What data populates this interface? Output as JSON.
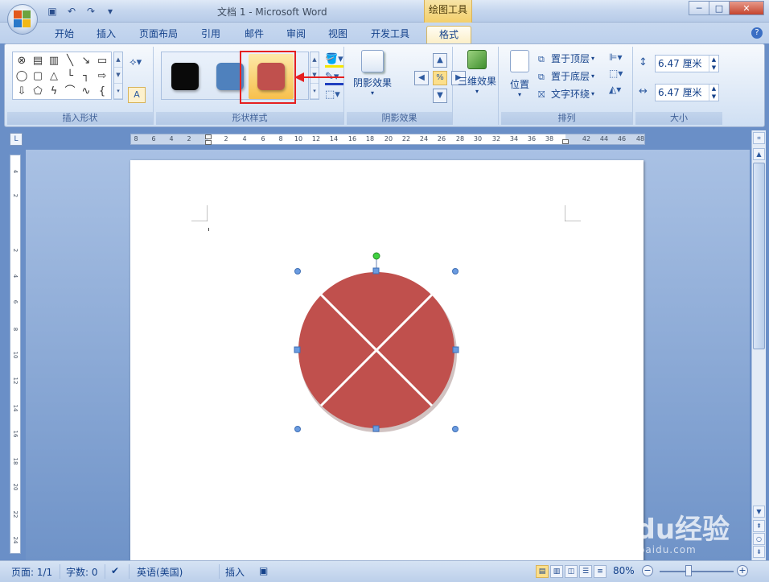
{
  "window": {
    "title": "文档 1 - Microsoft Word",
    "context_tab_group": "绘图工具",
    "controls": [
      "minimize-icon",
      "maximize-icon",
      "close-icon"
    ]
  },
  "quick_access": [
    "save-icon",
    "undo-icon",
    "redo-icon",
    "customize-icon"
  ],
  "tabs": [
    {
      "label": "开始"
    },
    {
      "label": "插入"
    },
    {
      "label": "页面布局"
    },
    {
      "label": "引用"
    },
    {
      "label": "邮件"
    },
    {
      "label": "审阅"
    },
    {
      "label": "视图"
    },
    {
      "label": "开发工具"
    },
    {
      "label": "格式",
      "active": true
    }
  ],
  "ribbon": {
    "groups": {
      "insert_shapes": {
        "label": "插入形状"
      },
      "shape_styles": {
        "label": "形状样式",
        "swatches": [
          {
            "color": "#0a0a0a"
          },
          {
            "color": "#4f81bd"
          },
          {
            "color": "#c0504d",
            "selected": true
          }
        ]
      },
      "shadow_effects": {
        "label": "阴影效果",
        "button": "阴影效果"
      },
      "three_d": {
        "label": "三维效果",
        "button": "三维效果"
      },
      "arrange": {
        "label": "排列",
        "position_button": "位置",
        "bring_to_front": "置于顶层",
        "send_to_back": "置于底层",
        "text_wrap": "文字环绕"
      },
      "size": {
        "label": "大小",
        "height": "6.47 厘米",
        "width": "6.47 厘米"
      }
    }
  },
  "ruler": {
    "h_labels": [
      "8",
      "6",
      "4",
      "2",
      "2",
      "4",
      "6",
      "8",
      "10",
      "12",
      "14",
      "16",
      "18",
      "20",
      "22",
      "24",
      "26",
      "28",
      "30",
      "32",
      "34",
      "36",
      "38",
      "42",
      "44",
      "46",
      "48"
    ],
    "v_labels": [
      "4",
      "2",
      "2",
      "4",
      "6",
      "8",
      "10",
      "12",
      "14",
      "16",
      "18",
      "20",
      "22",
      "24"
    ]
  },
  "document": {
    "shape": {
      "type": "circle",
      "fill": "#c0504d",
      "divider_color": "#ffffff"
    }
  },
  "status_bar": {
    "page": "页面: 1/1",
    "words": "字数: 0",
    "language": "英语(美国)",
    "mode": "插入",
    "zoom": "80%",
    "zoom_level": 80
  },
  "watermark": {
    "text": "Baidu经验",
    "sub": "jingyan.baidu.com"
  }
}
